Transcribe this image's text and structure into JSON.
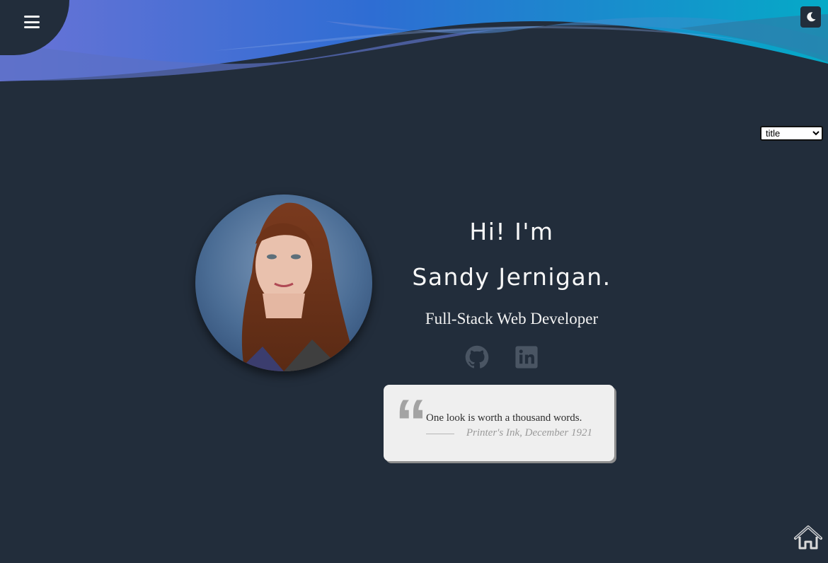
{
  "header": {
    "menu_icon": "hamburger-menu-icon",
    "theme_icon": "moon-icon"
  },
  "title_select": {
    "selected": "title",
    "options": [
      "title"
    ]
  },
  "hero": {
    "portrait_alt": "Sandy Jernigan",
    "greeting": "Hi! I'm",
    "name": "Sandy Jernigan.",
    "role": "Full-Stack Web Developer",
    "social_icons": [
      "github-icon",
      "linkedin-icon"
    ]
  },
  "quote": {
    "mark": "“",
    "text": "One look is worth a thousand words.",
    "author": "Printer's Ink, December 1921"
  },
  "footer": {
    "home_icon": "home-icon"
  },
  "colors": {
    "background": "#222d3b",
    "wave_blue": "#2f6fd6",
    "wave_cyan": "#0aa5c8",
    "social_icon": "#4a5563",
    "quote_card": "#efefef"
  }
}
